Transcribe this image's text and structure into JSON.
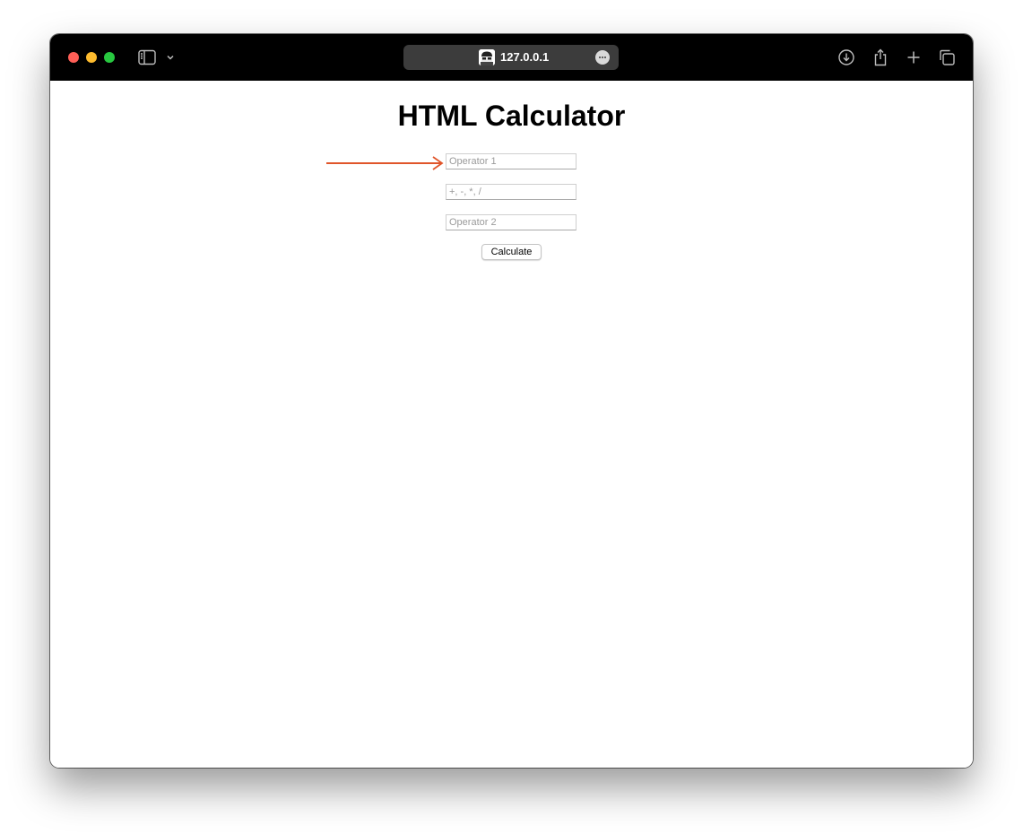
{
  "browser": {
    "url": "127.0.0.1",
    "colors": {
      "titlebar": "#000000",
      "urlbar": "#3c3c3c"
    }
  },
  "page": {
    "title": "HTML Calculator",
    "operator1_placeholder": "Operator 1",
    "operation_placeholder": "+, -, *, /",
    "operator2_placeholder": "Operator 2",
    "calculate_label": "Calculate"
  },
  "annotation": {
    "color": "#e0552a",
    "icon": "arrow-right-icon"
  }
}
